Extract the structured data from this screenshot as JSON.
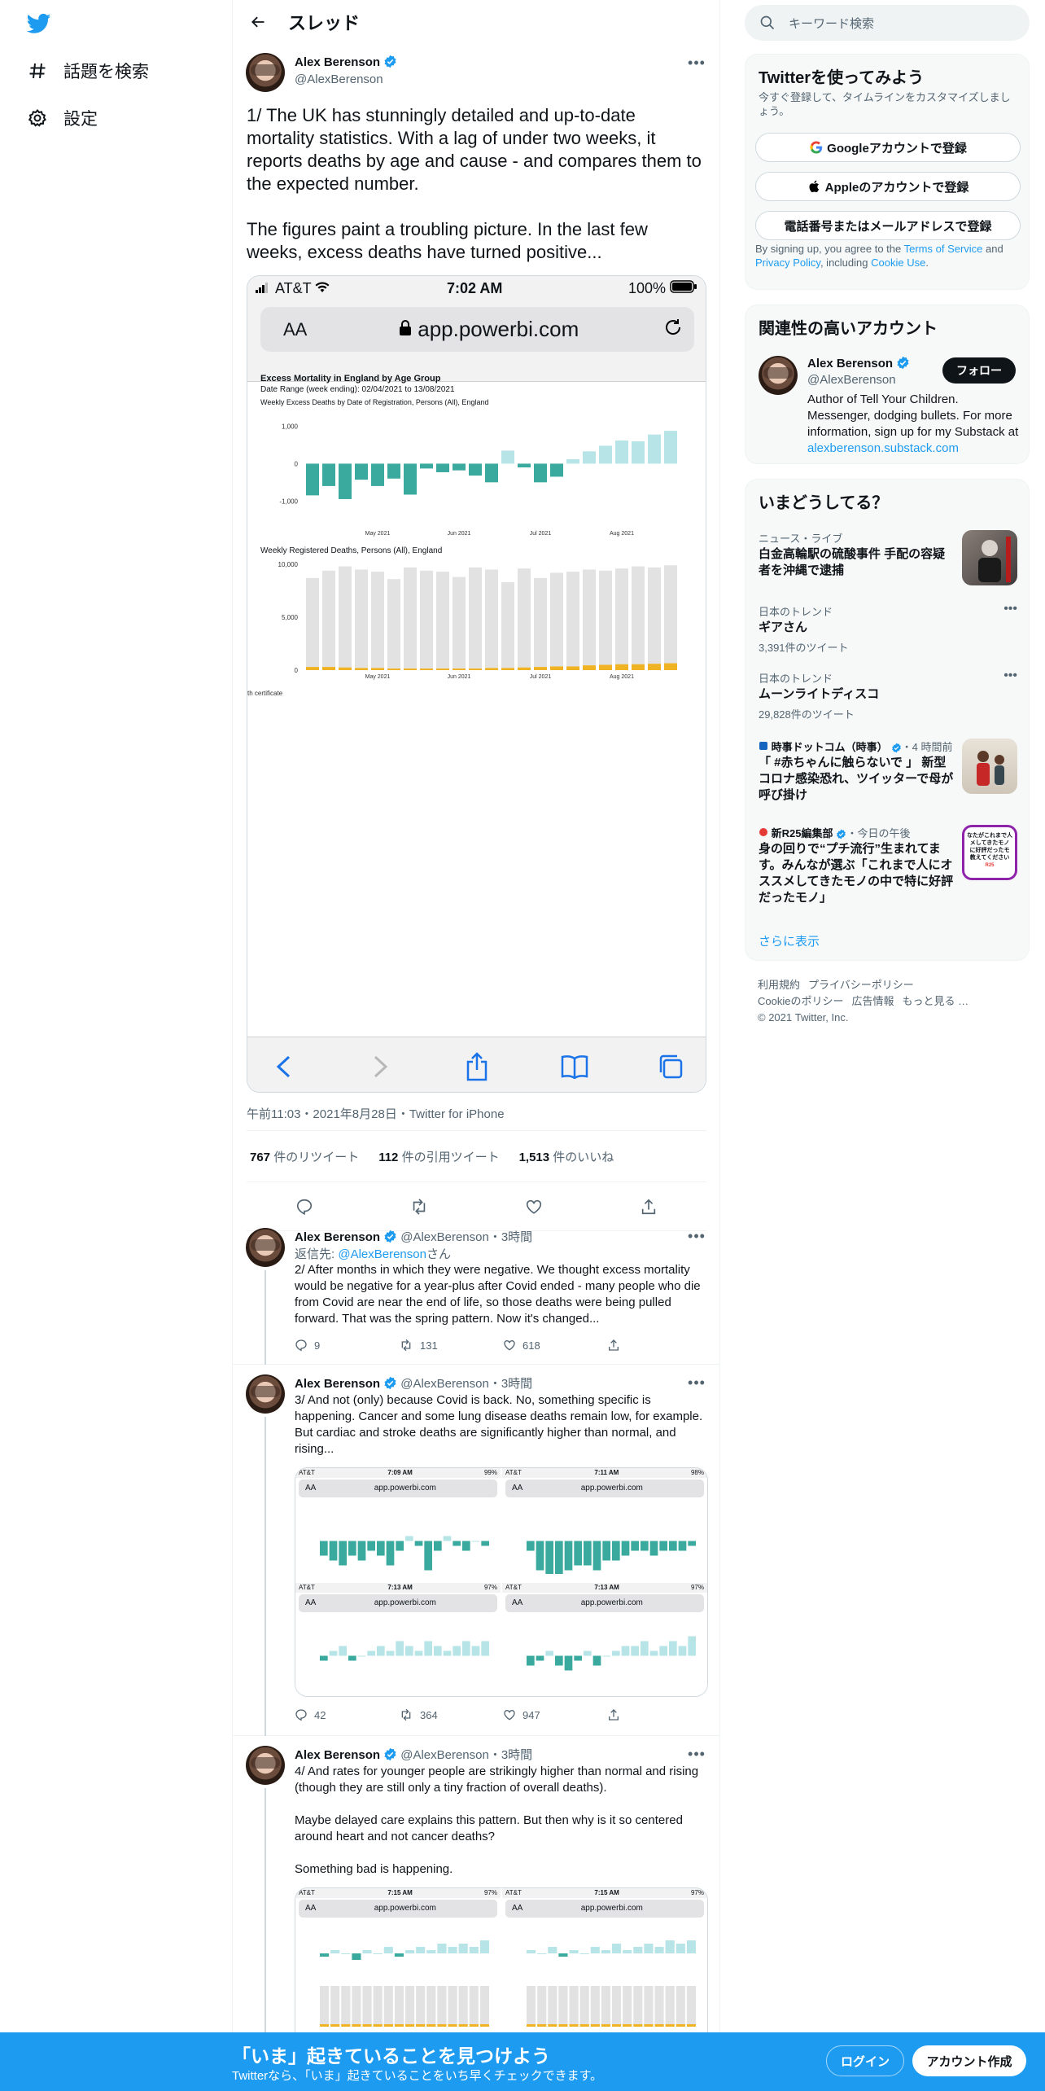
{
  "nav": {
    "explore": "話題を検索",
    "settings": "設定"
  },
  "header": {
    "title": "スレッド"
  },
  "main_tweet": {
    "name": "Alex Berenson",
    "handle": "@AlexBerenson",
    "text": "1/ The UK has stunningly detailed and up-to-date mortality statistics. With a lag of under two weeks, it reports deaths by age and cause - and compares them to the expected number.\n\nThe figures paint a troubling picture. In the last few weeks, excess deaths have turned positive...",
    "meta": "午前11:03・2021年8月28日・Twitter for iPhone",
    "retweets_count": "767",
    "retweets_label": " 件のリツイート",
    "quotes_count": "112",
    "quotes_label": " 件の引用ツイート",
    "likes_count": "1,513",
    "likes_label": " 件のいいね"
  },
  "phone": {
    "carrier": "AT&T",
    "time": "7:02 AM",
    "battery": "100%",
    "aa": "AA",
    "url": "app.powerbi.com",
    "chart_title": "Excess Mortality in England by Age Group",
    "chart_range": "Date Range (week ending): 02/04/2021 to 13/08/2021",
    "chart_sub": "Weekly Excess Deaths by Date of Registration, Persons (All), England",
    "chart2_title": "Weekly Registered Deaths, Persons (All), England",
    "cutoff": "th certificate"
  },
  "chart_data": [
    {
      "type": "bar",
      "title": "Weekly Excess Deaths by Date of Registration, Persons (All), England",
      "x_tick_labels": [
        "May 2021",
        "Jun 2021",
        "Jul 2021",
        "Aug 2021"
      ],
      "y_tick_labels": [
        "1,000",
        "0",
        "-1,000"
      ],
      "ylim": [
        -1300,
        1100
      ],
      "values": [
        -850,
        -600,
        -950,
        -430,
        -600,
        -400,
        -830,
        -130,
        -230,
        -180,
        -320,
        -500,
        350,
        -100,
        -500,
        -350,
        120,
        330,
        480,
        620,
        600,
        780,
        880
      ],
      "colors": {
        "positive": "#b7e4e6",
        "negative": "#3aaa9f"
      }
    },
    {
      "type": "bar",
      "title": "Weekly Registered Deaths, Persons (All), England",
      "x_tick_labels": [
        "May 2021",
        "Jun 2021",
        "Jul 2021",
        "Aug 2021"
      ],
      "y_tick_labels": [
        "10,000",
        "5,000",
        "0"
      ],
      "ylim": [
        0,
        10000
      ],
      "values": [
        8700,
        9400,
        9800,
        9500,
        9300,
        8600,
        9700,
        9400,
        9300,
        8800,
        9700,
        9500,
        8300,
        9600,
        8700,
        9200,
        9300,
        9500,
        9400,
        9600,
        9800,
        9700,
        9900
      ],
      "covid_values": [
        300,
        300,
        250,
        200,
        200,
        150,
        150,
        150,
        150,
        150,
        150,
        200,
        200,
        250,
        300,
        350,
        350,
        450,
        500,
        550,
        550,
        600,
        650
      ],
      "colors": {
        "total": "#e2e2e2",
        "covid": "#f0b323"
      }
    }
  ],
  "replies": [
    {
      "name": "Alex Berenson",
      "handle": "@AlexBerenson",
      "time": "・3時間",
      "replyto_prefix": "返信先: ",
      "replyto_handle": "@AlexBerenson",
      "replyto_suffix": "さん",
      "text": "2/ After months in which they were negative. We thought excess mortality would be negative for a year-plus after Covid ended - many people who die from Covid are near the end of life, so those deaths were being pulled forward. That was the spring pattern. Now it's changed...",
      "replies": "9",
      "retweets": "131",
      "likes": "618"
    },
    {
      "name": "Alex Berenson",
      "handle": "@AlexBerenson",
      "time": "・3時間",
      "text": "3/ And not (only) because Covid is back. No, something specific is happening. Cancer and some lung disease deaths remain low, for example. But cardiac and stroke deaths are significantly higher than normal, and rising...",
      "replies": "42",
      "retweets": "364",
      "likes": "947",
      "images": [
        {
          "time": "7:09 AM",
          "battery": "99%"
        },
        {
          "time": "7:11 AM",
          "battery": "98%"
        },
        {
          "time": "7:13 AM",
          "battery": "97%"
        },
        {
          "time": "7:13 AM",
          "battery": "97%"
        }
      ]
    },
    {
      "name": "Alex Berenson",
      "handle": "@AlexBerenson",
      "time": "・3時間",
      "text": "4/ And rates for younger people are strikingly higher than normal and rising (though they are still only a tiny fraction of overall deaths).\n\nMaybe delayed care explains this pattern. But then why is it so centered around heart and not cancer deaths?\n\nSomething bad is happening.",
      "images": [
        {
          "time": "7:15 AM",
          "battery": "97%"
        },
        {
          "time": "7:15 AM",
          "battery": "97%"
        }
      ]
    }
  ],
  "mini_common": {
    "carrier": "AT&T",
    "aa": "AA",
    "url": "app.powerbi.com"
  },
  "right": {
    "search_placeholder": "キーワード検索",
    "signup_title": "Twitterを使ってみよう",
    "signup_sub": "今すぐ登録して、タイムラインをカスタマイズしましょう。",
    "google_btn": "Googleアカウントで登録",
    "apple_btn": "Appleのアカウントで登録",
    "phone_btn": "電話番号またはメールアドレスで登録",
    "legal_1": "By signing up, you agree to the ",
    "legal_tos": "Terms of Service",
    "legal_2": " and ",
    "legal_privacy": "Privacy Policy",
    "legal_3": ", including ",
    "legal_cookie": "Cookie Use",
    "legal_4": ".",
    "related_title": "関連性の高いアカウント",
    "related_name": "Alex Berenson",
    "related_handle": "@AlexBerenson",
    "follow": "フォロー",
    "related_bio": "Author of Tell Your Children. Messenger, dodging bullets. For more information, sign up for my Substack at ",
    "related_link": "alexberenson.substack.com",
    "trends_title": "いまどうしてる？",
    "trends": [
      {
        "meta": "ニュース・ライブ",
        "title": "白金高輪駅の硫酸事件 手配の容疑者を沖縄で逮捕"
      },
      {
        "meta": "日本のトレンド",
        "title": "ギアさん",
        "count": "3,391件のツイート"
      },
      {
        "meta": "日本のトレンド",
        "title": "ムーンライトディスコ",
        "count": "29,828件のツイート"
      },
      {
        "meta_source": "時事ドットコム（時事）",
        "meta_time": "・4 時間前",
        "title": "「 #赤ちゃんに触らないで 」 新型コロナ感染恐れ、ツイッターで母が呼び掛け"
      },
      {
        "meta_source": "新R25編集部",
        "meta_time": "・今日の午後",
        "title": "身の回りで“プチ流行”生まれてます。みんなが選ぶ「これまで人にオススメしてきたモノの中で特に好評だったモノ」"
      }
    ],
    "show_more": "さらに表示",
    "footer": [
      "利用規約",
      "プライバシーポリシー",
      "Cookieのポリシー",
      "広告情報",
      "もっと見る …",
      "© 2021 Twitter, Inc."
    ],
    "trend5_img_text": "なたがこれまで人\nメしてきたモノ\nに好評だったモ\n教えてください",
    "trend5_img_badge": "R25"
  },
  "banner": {
    "title": "「いま」起きていることを見つけよう",
    "sub": "Twitterなら、「いま」起きていることをいち早くチェックできます。",
    "login": "ログイン",
    "signup": "アカウント作成"
  }
}
